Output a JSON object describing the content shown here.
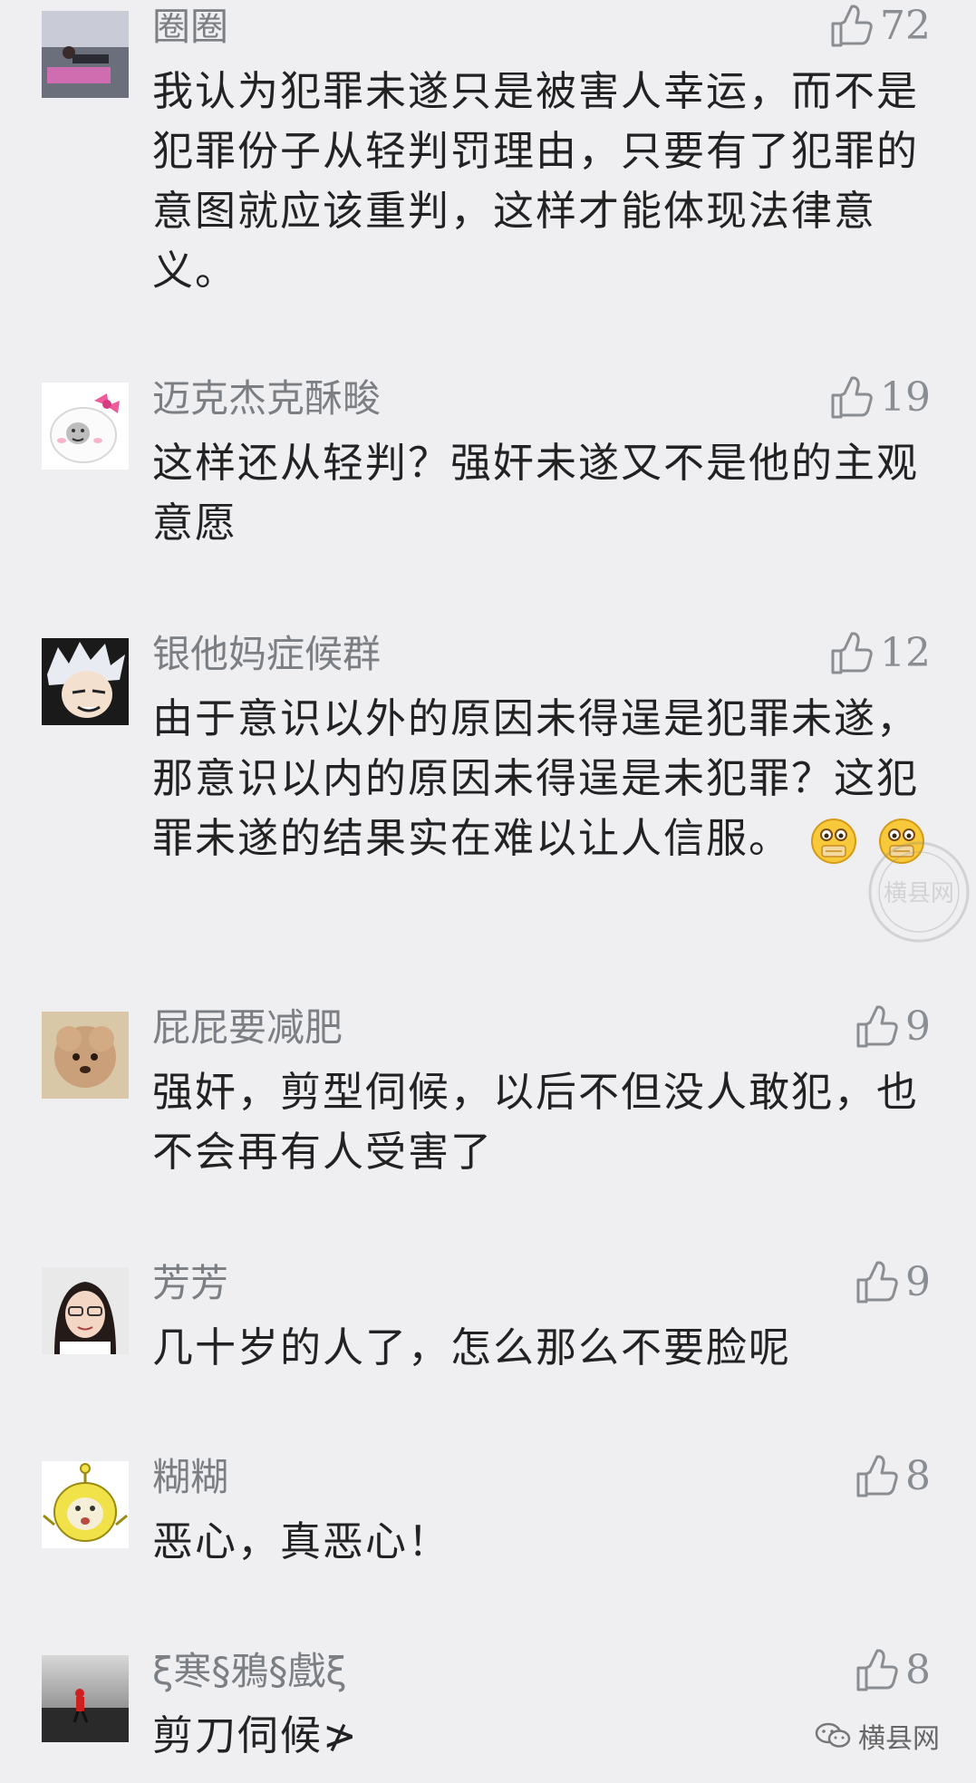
{
  "comments": [
    {
      "name": "圈圈",
      "likes": "72",
      "text": "我认为犯罪未遂只是被害人幸运，而不是犯罪份子从轻判罚理由，只要有了犯罪的意图就应该重判，这样才能体现法律意义。"
    },
    {
      "name": "迈克杰克酥畯",
      "likes": "19",
      "text": "这样还从轻判？强奸未遂又不是他的主观意愿"
    },
    {
      "name": "银他妈症候群",
      "likes": "12",
      "text": "由于意识以外的原因未得逞是犯罪未遂，那意识以内的原因未得逞是未犯罪？这犯罪未遂的结果实在难以让人信服。"
    },
    {
      "name": "屁屁要减肥",
      "likes": "9",
      "text": "强奸，剪型伺候，以后不但没人敢犯，也不会再有人受害了"
    },
    {
      "name": "芳芳",
      "likes": "9",
      "text": "几十岁的人了，怎么那么不要脸呢"
    },
    {
      "name": "糊糊",
      "likes": "8",
      "text": "恶心，真恶心！"
    },
    {
      "name": "ξ寒§鴉§戲ξ",
      "likes": "8",
      "text": "剪刀伺候≯"
    }
  ],
  "footer": {
    "brand": "横县网"
  },
  "watermark": {
    "text": "横县网"
  }
}
